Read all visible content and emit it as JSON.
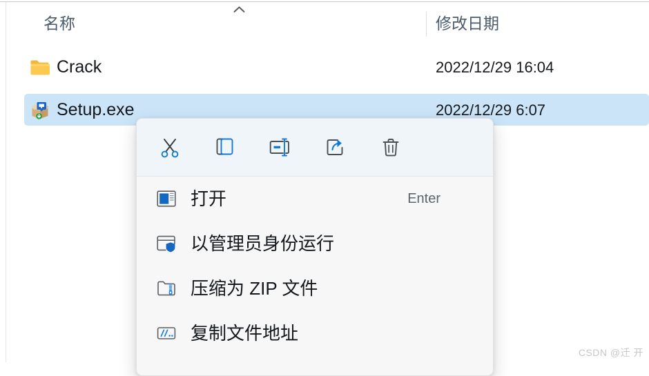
{
  "explorer": {
    "columns": [
      {
        "key": "name",
        "label": "名称",
        "sort_indicator": "chevron-up-icon"
      },
      {
        "key": "date_modified",
        "label": "修改日期"
      }
    ],
    "rows": [
      {
        "name": "Crack",
        "icon": "folder-icon",
        "date_modified": "2022/12/29 16:04",
        "selected": false
      },
      {
        "name": "Setup.exe",
        "icon": "installer-package-icon",
        "date_modified": "2022/12/29 6:07",
        "selected": true
      }
    ],
    "selection_color": "#cce4f7"
  },
  "context_menu": {
    "toolbar": [
      {
        "name": "cut-icon",
        "label": "剪切"
      },
      {
        "name": "copy-icon",
        "label": "复制"
      },
      {
        "name": "rename-icon",
        "label": "重命名"
      },
      {
        "name": "share-icon",
        "label": "共享"
      },
      {
        "name": "delete-icon",
        "label": "删除"
      }
    ],
    "items": [
      {
        "icon": "open-window-icon",
        "label": "打开",
        "accelerator": "Enter"
      },
      {
        "icon": "shield-admin-icon",
        "label": "以管理员身份运行",
        "accelerator": ""
      },
      {
        "icon": "zip-folder-icon",
        "label": "压缩为 ZIP 文件",
        "accelerator": ""
      },
      {
        "icon": "copy-path-icon",
        "label": "复制文件地址",
        "accelerator": ""
      }
    ],
    "accent_color": "#0f7bd6"
  },
  "watermark": {
    "text": "CSDN @迁 开"
  }
}
